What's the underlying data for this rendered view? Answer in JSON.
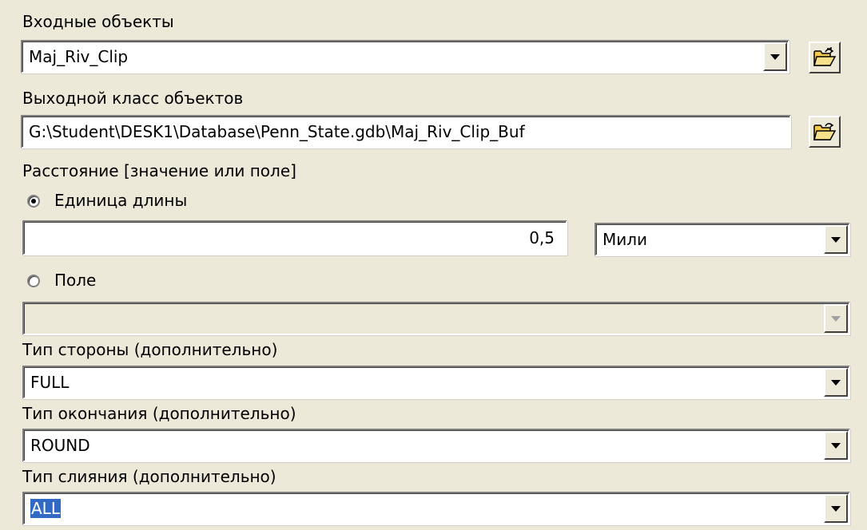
{
  "input_features": {
    "label": "Входные объекты",
    "value": "Maj_Riv_Clip"
  },
  "output_class": {
    "label": "Выходной класс объектов",
    "value": "G:\\Student\\DESK1\\Database\\Penn_State.gdb\\Maj_Riv_Clip_Buf"
  },
  "distance": {
    "label": "Расстояние [значение или поле]",
    "linear_unit_label": "Единица длины",
    "linear_unit_selected": true,
    "value": "0,5",
    "unit": "Мили",
    "field_label": "Поле",
    "field_value": ""
  },
  "side_type": {
    "label": "Тип стороны (дополнительно)",
    "value": "FULL"
  },
  "end_type": {
    "label": "Тип окончания (дополнительно)",
    "value": "ROUND"
  },
  "dissolve_type": {
    "label": "Тип слияния (дополнительно)",
    "value": "ALL"
  },
  "icons": {
    "browse": "folder-open-icon",
    "dropdown": "chevron-down-icon"
  },
  "colors": {
    "background": "#ece9d8",
    "selection": "#316ac5",
    "folder": "#f2c94c"
  }
}
